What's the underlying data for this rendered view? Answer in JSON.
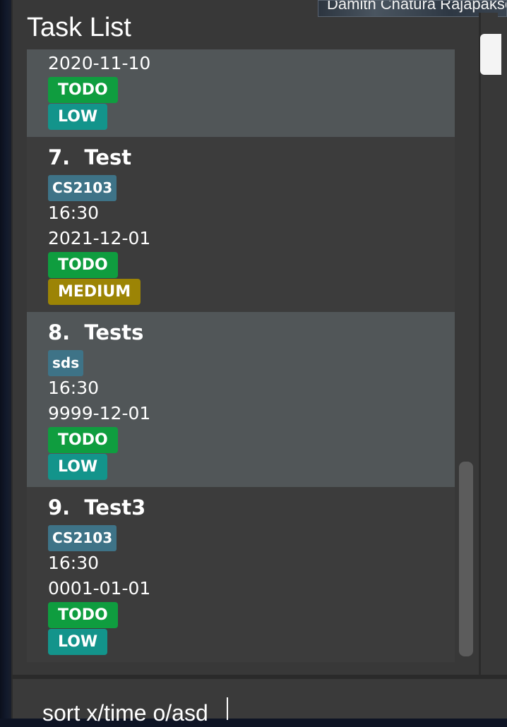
{
  "overlay_text": "Damith Chatura Rajapakse",
  "panel_title": "Task List",
  "colors": {
    "todo": "#0f9d3f",
    "low": "#13948b",
    "medium": "#9c8405",
    "tag": "#3e7387"
  },
  "tasks": [
    {
      "title": "",
      "tags": [],
      "time": "",
      "date": "2020-11-10",
      "status": "TODO",
      "priority": "LOW"
    },
    {
      "title": "7.  Test",
      "tags": [
        "CS2103"
      ],
      "time": "16:30",
      "date": "2021-12-01",
      "status": "TODO",
      "priority": "MEDIUM"
    },
    {
      "title": "8.  Tests",
      "tags": [
        "sds"
      ],
      "time": "16:30",
      "date": "9999-12-01",
      "status": "TODO",
      "priority": "LOW"
    },
    {
      "title": "9.  Test3",
      "tags": [
        "CS2103"
      ],
      "time": "16:30",
      "date": "0001-01-01",
      "status": "TODO",
      "priority": "LOW"
    }
  ],
  "command": {
    "value": "sort x/time o/asd"
  }
}
